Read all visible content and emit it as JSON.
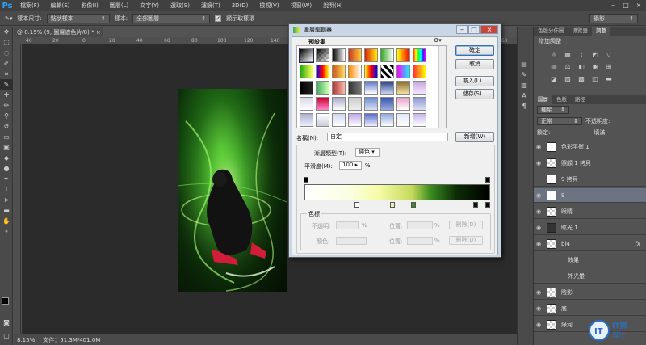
{
  "app": {
    "logo": "Ps"
  },
  "menu": [
    "檔案(F)",
    "編輯(E)",
    "影像(I)",
    "圖層(L)",
    "文字(Y)",
    "選取(S)",
    "濾鏡(T)",
    "3D(D)",
    "檢視(V)",
    "視窗(W)",
    "說明(H)"
  ],
  "window_controls": [
    "–",
    "□",
    "×"
  ],
  "options": {
    "sample_size_label": "樣本尺寸:",
    "sample_size_value": "點狀樣本",
    "sample_label": "樣本:",
    "sample_value": "全部圖層",
    "show_ring_label": "顯示取樣環",
    "workspace": "攝影"
  },
  "document": {
    "tab_title": "@ 8.15% (9, 圖層遮色片/8) *",
    "tab_close": "×",
    "status_zoom": "8.15%",
    "status_doc": "文件：51.3M/401.0M"
  },
  "ruler_ticks": [
    "40",
    "20",
    "0",
    "20",
    "40",
    "60",
    "80",
    "100",
    "120",
    "140",
    "160",
    "180",
    "200"
  ],
  "dialog": {
    "title": "漸層編輯器",
    "presets_label": "預設集",
    "ok": "確定",
    "cancel": "取消",
    "load": "載入(L)...",
    "save": "儲存(S)...",
    "name_label": "名稱(N):",
    "name_value": "自定",
    "new_button": "新增(W)",
    "gradient_type_label": "漸層類型(T):",
    "gradient_type_value": "純色",
    "smoothness_label": "平滑度(M):",
    "smoothness_value": "100",
    "smoothness_unit": "%",
    "stops_group": "色標",
    "opacity_label": "不透明:",
    "opacity_unit": "%",
    "location_label": "位置:",
    "location_unit": "%",
    "delete_button": "刪除(D)",
    "color_label": "顏色:",
    "color_location_label": "位置:",
    "color_location_unit": "%",
    "color_delete_button": "刪除(D)"
  },
  "panels": {
    "adjust_tabs": [
      "色版分佈圖",
      "導覽器",
      "調整"
    ],
    "adjust_title": "增加調整",
    "layers_tabs": [
      "圖層",
      "色版",
      "路徑"
    ],
    "kind_label": "種類",
    "blend_mode": "正常",
    "opacity_label": "不透明度:",
    "lock_label": "鎖定:",
    "fill_label": "填滿:",
    "layers": [
      {
        "name": "色彩平衡 1",
        "thumb": "white",
        "visible": true,
        "selected": false
      },
      {
        "name": "照顧 1 拷貝",
        "thumb": "checker",
        "visible": true,
        "selected": false
      },
      {
        "name": "9 拷貝",
        "thumb": "white",
        "visible": false,
        "selected": false
      },
      {
        "name": "9",
        "thumb": "white",
        "visible": true,
        "selected": true
      },
      {
        "name": "眼睛",
        "thumb": "checker",
        "visible": true,
        "selected": false
      },
      {
        "name": "眩光 1",
        "thumb": "dark",
        "visible": true,
        "selected": false
      },
      {
        "name": "bl4",
        "thumb": "checker",
        "visible": true,
        "selected": false
      },
      {
        "name": "效果",
        "thumb": "none",
        "visible": false,
        "selected": false
      },
      {
        "name": "外光暈",
        "thumb": "none",
        "visible": false,
        "selected": false
      },
      {
        "name": "陰影",
        "thumb": "checker",
        "visible": true,
        "selected": false
      },
      {
        "name": "底",
        "thumb": "checker",
        "visible": true,
        "selected": false
      },
      {
        "name": "綠河",
        "thumb": "checker",
        "visible": true,
        "selected": false
      }
    ],
    "fx_label": "fx"
  },
  "watermark": {
    "text": "IT邦",
    "subtext": "幫忙"
  }
}
